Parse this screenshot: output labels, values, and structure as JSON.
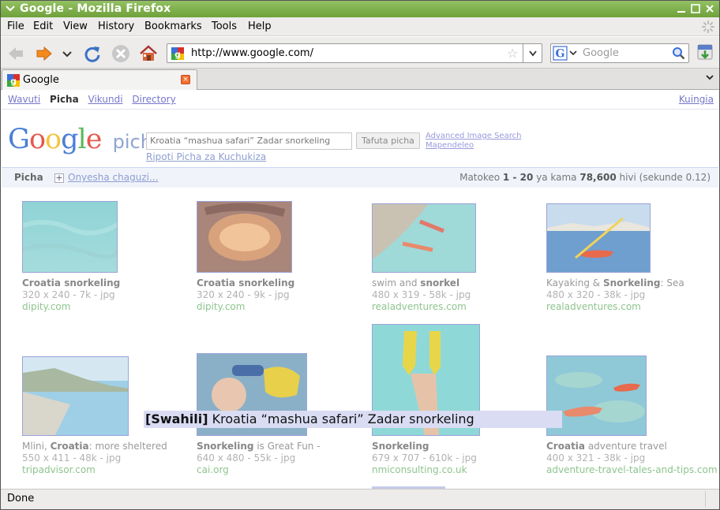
{
  "window": {
    "title": "Google - Mozilla Firefox"
  },
  "menu": [
    "File",
    "Edit",
    "View",
    "History",
    "Bookmarks",
    "Tools",
    "Help"
  ],
  "toolbar": {
    "url": "http://www.google.com/",
    "search_placeholder": "Google"
  },
  "tab": {
    "label": "Google"
  },
  "page": {
    "nav": [
      {
        "label": "Wavuti",
        "current": false
      },
      {
        "label": "Picha",
        "current": true
      },
      {
        "label": "Vikundi",
        "current": false
      },
      {
        "label": "Directory",
        "current": false
      }
    ],
    "sign_in": "Kuingia",
    "logo_word": "Google",
    "logo_sub": "picha",
    "query": "Kroatia “mashua safari” Zadar snorkeling",
    "search_button": "Tafuta picha",
    "advanced_link": "Advanced Image Search",
    "prefs_link": "Mapendeleo",
    "report_link": "Ripoti Picha za Kuchukiza",
    "results_label": "Picha",
    "show_options": "Onyesha chaguzi...",
    "stats": {
      "prefix": "Matokeo ",
      "range": "1 - 20",
      "mid": " ya kama ",
      "total": "78,600",
      "suffix": " hivi (sekunde 0.12)"
    },
    "results": [
      {
        "title_pre": "",
        "title_bold": "Croatia snorkeling",
        "title_post": "",
        "meta": "320 x 240 - 7k - jpg",
        "domain": "dipity.com",
        "thumb": "underwater-teal"
      },
      {
        "title_pre": "",
        "title_bold": "Croatia snorkeling",
        "title_post": "",
        "meta": "320 x 240 - 9k - jpg",
        "domain": "dipity.com",
        "thumb": "sea-cave"
      },
      {
        "title_pre": "swim and ",
        "title_bold": "snorkel",
        "title_post": "",
        "meta": "480 x 319 - 58k - jpg",
        "domain": "realadventures.com",
        "thumb": "kayaks-beach"
      },
      {
        "title_pre": "Kayaking & ",
        "title_bold": "Snorkeling",
        "title_post": ": Sea",
        "meta": "480 x 320 - 38k - jpg",
        "domain": "realadventures.com",
        "thumb": "kayak-sea"
      },
      {
        "title_pre": "Mlini, ",
        "title_bold": "Croatia",
        "title_post": ": more sheltered",
        "meta": "550 x 411 - 48k - jpg",
        "domain": "tripadvisor.com",
        "thumb": "coast"
      },
      {
        "title_pre": "",
        "title_bold": "Snorkeling",
        "title_post": " is Great Fun -",
        "meta": "640 x 480 - 55k - jpg",
        "domain": "cai.org",
        "thumb": "child-snorkel"
      },
      {
        "title_pre": "",
        "title_bold": "Snorkeling",
        "title_post": "",
        "meta": "679 x 707 - 610k - jpg",
        "domain": "nmiconsulting.co.uk",
        "thumb": "fins"
      },
      {
        "title_pre": "",
        "title_bold": "Croatia",
        "title_post": " adventure travel",
        "meta": "400 x 321 - 38k - jpg",
        "domain": "adventure-travel-tales-and-tips.com",
        "thumb": "kayaks-reef"
      }
    ],
    "tooltip": {
      "tag": "[Swahili]",
      "text": " Kroatia “mashua safari” Zadar snorkeling"
    }
  },
  "status": "Done",
  "colors": {
    "titlebar": "#79aa45",
    "link": "#7777cc",
    "domain": "#8ec48e",
    "tooltip_bg": "#d9dcf3"
  }
}
